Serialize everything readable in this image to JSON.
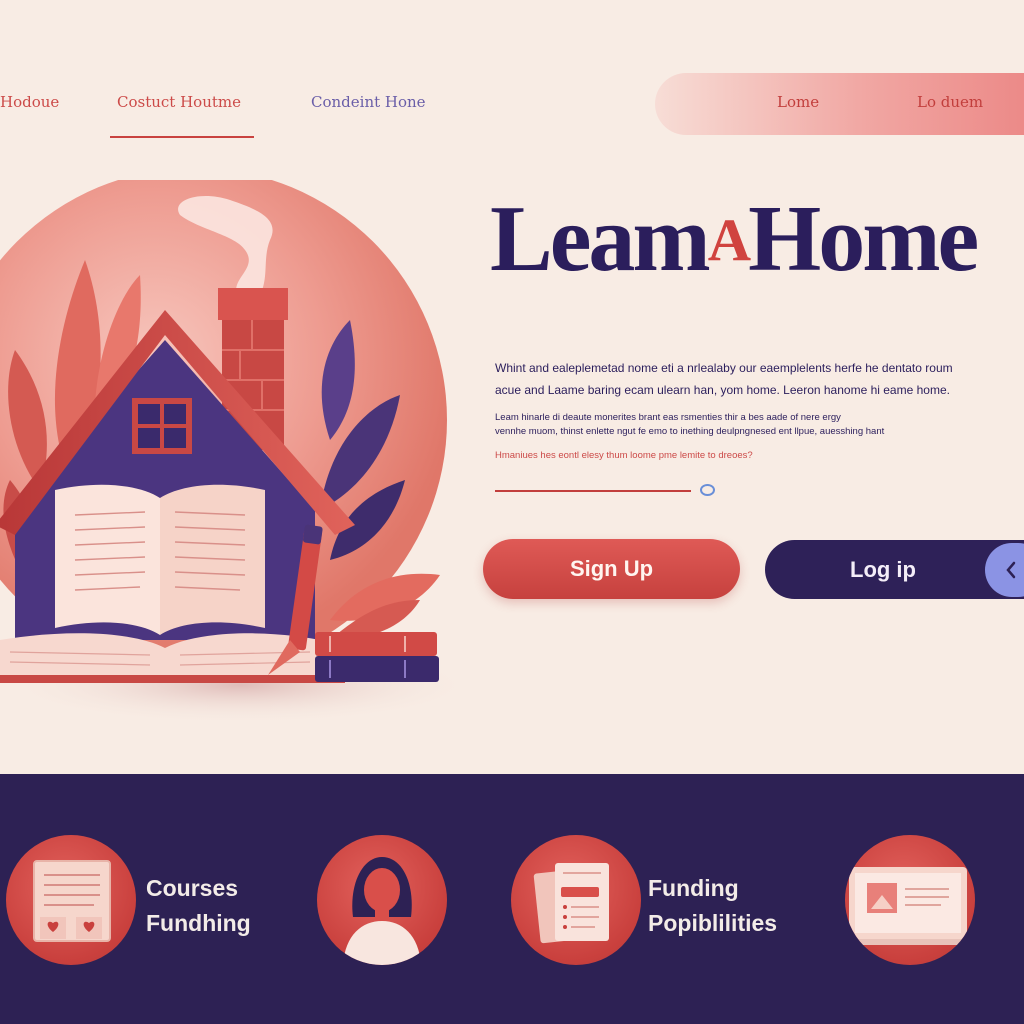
{
  "nav": {
    "links": [
      "Hodoue",
      "Costuct Houtme",
      "Condeint Hone"
    ],
    "pill_links": [
      "Lome",
      "Lo duem"
    ]
  },
  "hero": {
    "title_part1": "Leam",
    "title_accent": "A",
    "title_part2": "Home",
    "desc_lines": [
      "Whint and ealeplemetad nome eti a nrlealaby our eaemplelents herfe he dentato roum",
      "acue and Laame baring ecam ulearn han, yom home.  Leeron hanome hi eame home.",
      "Leam hinarle di deaute monerites brant eas rsmenties thir a bes aade of nere ergy",
      "vennhe muom, thinst enlette ngut fe emo to inething deulpngnesed ent llpue, auesshing hant",
      "Hmaniues hes eontl elesy thum loome pme lemite to dreoes?"
    ],
    "slider": {
      "value": 0.95
    }
  },
  "buttons": {
    "signup": "Sign Up",
    "login": "Log ip"
  },
  "features": [
    {
      "icon": "book-icon",
      "lines": [
        "Courses",
        "Fundhing"
      ]
    },
    {
      "icon": "person-icon",
      "lines": []
    },
    {
      "icon": "documents-icon",
      "lines": [
        "Funding",
        "Popiblilities"
      ]
    },
    {
      "icon": "laptop-icon",
      "lines": []
    }
  ],
  "colors": {
    "background": "#f8ece4",
    "accent_red": "#c9423f",
    "navy": "#2d2154",
    "pill_pink": "#f1a8a4",
    "arrow_blue": "#8b93e4"
  }
}
